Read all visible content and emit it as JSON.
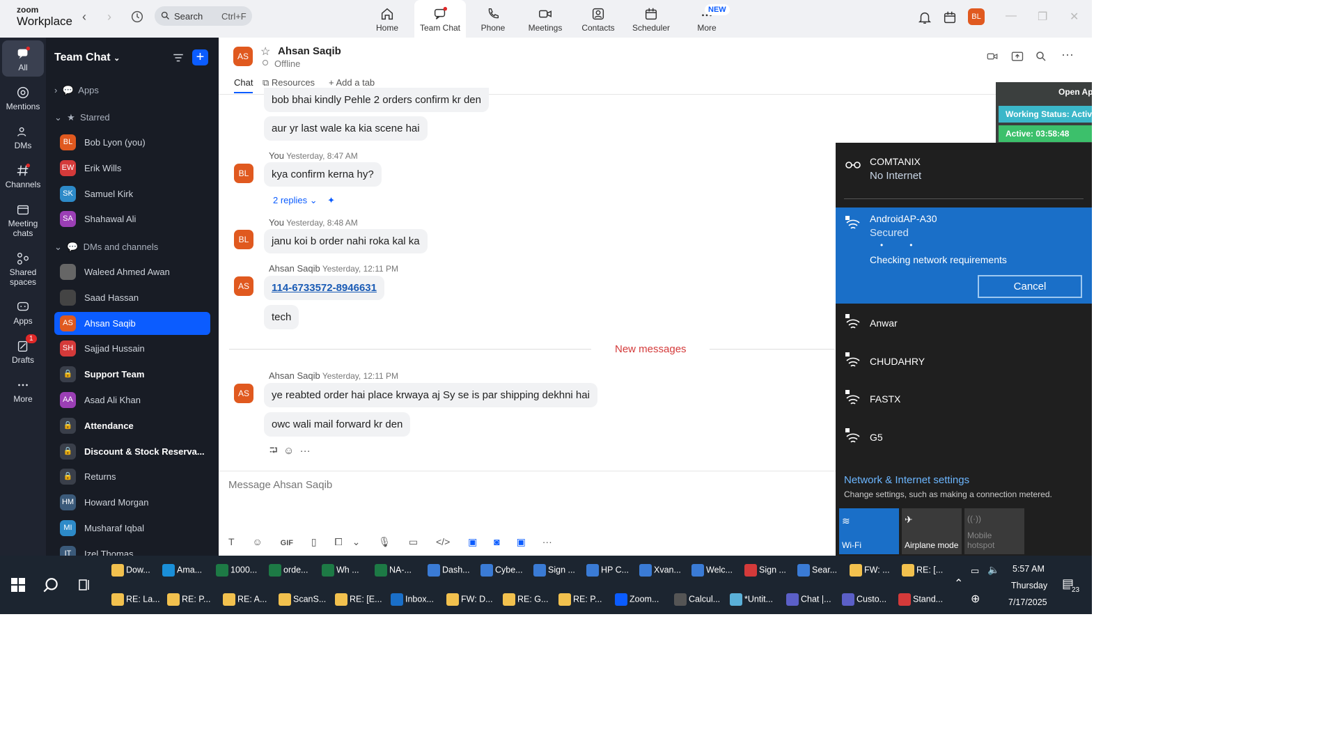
{
  "app": {
    "brand_line1": "zoom",
    "brand_line2": "Workplace"
  },
  "search": {
    "label": "Search",
    "shortcut": "Ctrl+F"
  },
  "nav": [
    {
      "label": "Home"
    },
    {
      "label": "Team Chat"
    },
    {
      "label": "Phone"
    },
    {
      "label": "Meetings"
    },
    {
      "label": "Contacts"
    },
    {
      "label": "Scheduler"
    },
    {
      "label": "More"
    }
  ],
  "nav_new_badge": "NEW",
  "user_avatar": "BL",
  "rail": [
    {
      "label": "All"
    },
    {
      "label": "Mentions"
    },
    {
      "label": "DMs"
    },
    {
      "label": "Channels"
    },
    {
      "label": "Meeting chats"
    },
    {
      "label": "Shared spaces"
    },
    {
      "label": "Apps"
    },
    {
      "label": "Drafts"
    },
    {
      "label": "More"
    }
  ],
  "rail_drafts_badge": "1",
  "sidebar": {
    "title": "Team Chat",
    "apps_label": "Apps",
    "starred_label": "Starred",
    "dms_label": "DMs and channels",
    "starred": [
      {
        "initials": "BL",
        "name": "Bob Lyon (you)",
        "color": "#e0591f"
      },
      {
        "initials": "EW",
        "name": "Erik Wills",
        "color": "#d43a3a"
      },
      {
        "initials": "SK",
        "name": "Samuel Kirk",
        "color": "#2d8ac8"
      },
      {
        "initials": "SA",
        "name": "Shahawal Ali",
        "color": "#9b3fb5"
      }
    ],
    "dms": [
      {
        "initials": "",
        "name": "Waleed Ahmed Awan",
        "color": "#666",
        "bold": false
      },
      {
        "initials": "",
        "name": "Saad Hassan",
        "color": "#444",
        "bold": false
      },
      {
        "initials": "AS",
        "name": "Ahsan Saqib",
        "color": "#e0591f",
        "bold": false,
        "selected": true
      },
      {
        "initials": "SH",
        "name": "Sajjad Hussain",
        "color": "#d43a3a",
        "bold": false
      },
      {
        "initials": "",
        "name": "Support Team",
        "color": "#3a3f4a",
        "bold": true
      },
      {
        "initials": "AA",
        "name": "Asad Ali Khan",
        "color": "#9b3fb5",
        "bold": false
      },
      {
        "initials": "",
        "name": "Attendance",
        "color": "#3a3f4a",
        "bold": true
      },
      {
        "initials": "",
        "name": "Discount & Stock Reserva...",
        "color": "#3a3f4a",
        "bold": true
      },
      {
        "initials": "",
        "name": "Returns",
        "color": "#3a3f4a",
        "bold": false
      },
      {
        "initials": "HM",
        "name": "Howard Morgan",
        "color": "#3b5a7a",
        "bold": false
      },
      {
        "initials": "MI",
        "name": "Musharaf Iqbal",
        "color": "#2d8ac8",
        "bold": false
      },
      {
        "initials": "IT",
        "name": "Izel Thomas",
        "color": "#3b5a7a",
        "bold": false
      }
    ]
  },
  "chat": {
    "contact_initials": "AS",
    "contact_name": "Ahsan Saqib",
    "status": "Offline",
    "tabs": [
      {
        "label": "Chat"
      },
      {
        "label": "Resources"
      },
      {
        "label": "Add a tab"
      }
    ],
    "messages": {
      "m1": "bob bhai kindly Pehle 2 orders confirm kr den",
      "m2": "aur yr last wale ka kia scene hai",
      "g2_sender": "You",
      "g2_time": "Yesterday, 8:47 AM",
      "m3": "kya confirm kerna hy?",
      "replies": "2 replies",
      "g3_sender": "You",
      "g3_time": "Yesterday, 8:48 AM",
      "m4": "janu koi b order nahi roka kal ka",
      "g4_sender": "Ahsan Saqib",
      "g4_time": "Yesterday, 12:11 PM",
      "m5": "114-6733572-8946631",
      "m6": "tech",
      "new_messages": "New messages",
      "g5_sender": "Ahsan Saqib",
      "g5_time": "Yesterday, 12:11 PM",
      "m7": "ye reabted order hai place krwaya aj Sy se is par shipping dekhni hai",
      "m8": "owc wali mail forward kr den"
    },
    "composer_placeholder": "Message Ahsan Saqib"
  },
  "overlay": {
    "open_app": "Open Ap",
    "working_status": "Working Status: Activ",
    "active": "Active: 03:58:48"
  },
  "wifi": {
    "current_name": "COMTANIX",
    "current_status": "No Internet",
    "connecting_name": "AndroidAP-A30",
    "connecting_status": "Secured",
    "checking": "Checking network requirements",
    "cancel": "Cancel",
    "networks": [
      {
        "name": "Anwar"
      },
      {
        "name": "CHUDAHRY"
      },
      {
        "name": "FASTX"
      },
      {
        "name": "G5"
      }
    ],
    "settings_link": "Network & Internet settings",
    "settings_desc": "Change settings, such as making a connection metered.",
    "quick": [
      {
        "label": "Wi-Fi"
      },
      {
        "label": "Airplane mode"
      },
      {
        "label": "Mobile hotspot"
      }
    ]
  },
  "taskbar": {
    "row1": [
      {
        "label": "Dow...",
        "color": "#f2c14e"
      },
      {
        "label": "Ama...",
        "color": "#1a8fd8"
      },
      {
        "label": "1000...",
        "color": "#1d7a45"
      },
      {
        "label": "orde...",
        "color": "#1d7a45"
      },
      {
        "label": "Wh ...",
        "color": "#1d7a45"
      },
      {
        "label": "NA-...",
        "color": "#1d7a45"
      },
      {
        "label": "Dash...",
        "color": "#3a7bd5"
      },
      {
        "label": "Cybe...",
        "color": "#3a7bd5"
      },
      {
        "label": "Sign ...",
        "color": "#3a7bd5"
      },
      {
        "label": "HP C...",
        "color": "#3a7bd5"
      },
      {
        "label": "Xvan...",
        "color": "#3a7bd5"
      },
      {
        "label": "Welc...",
        "color": "#3a7bd5"
      },
      {
        "label": "Sign ...",
        "color": "#d43a3a"
      },
      {
        "label": "Sear...",
        "color": "#3a7bd5"
      },
      {
        "label": "FW: ...",
        "color": "#f2c14e"
      },
      {
        "label": "RE: [...",
        "color": "#f2c14e"
      }
    ],
    "row2": [
      {
        "label": "RE: La...",
        "color": "#f2c14e"
      },
      {
        "label": "RE: P...",
        "color": "#f2c14e"
      },
      {
        "label": "RE: A...",
        "color": "#f2c14e"
      },
      {
        "label": "ScanS...",
        "color": "#f2c14e"
      },
      {
        "label": "RE: [E...",
        "color": "#f2c14e"
      },
      {
        "label": "Inbox...",
        "color": "#1a6fc8"
      },
      {
        "label": "FW: D...",
        "color": "#f2c14e"
      },
      {
        "label": "RE: G...",
        "color": "#f2c14e"
      },
      {
        "label": "RE: P...",
        "color": "#f2c14e"
      },
      {
        "label": "Zoom...",
        "color": "#0b5cff"
      },
      {
        "label": "Calcul...",
        "color": "#555"
      },
      {
        "label": "*Untit...",
        "color": "#5ab0d8"
      },
      {
        "label": "Chat |...",
        "color": "#5b5fc7"
      },
      {
        "label": "Custo...",
        "color": "#5b5fc7"
      },
      {
        "label": "Stand...",
        "color": "#d43a3a"
      }
    ],
    "time": "5:57 AM",
    "day": "Thursday",
    "date": "7/17/2025",
    "notif_count": "23"
  }
}
